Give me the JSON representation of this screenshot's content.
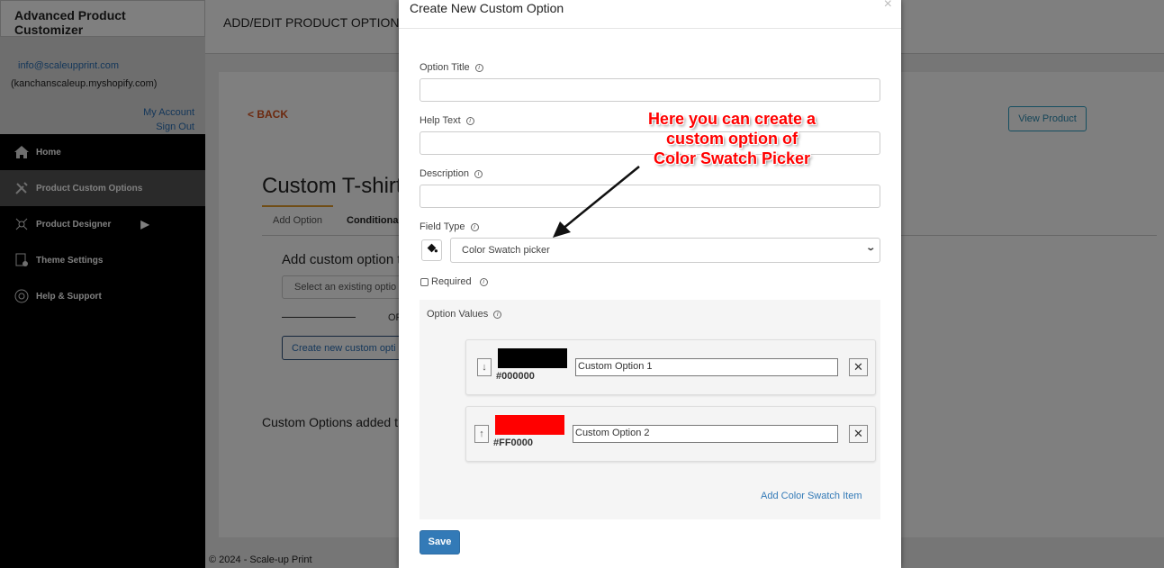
{
  "sidebar": {
    "app_title": "Advanced Product Customizer",
    "email": "info@scaleupprint.com",
    "shop": "(kanchanscaleup.myshopify.com)",
    "my_account": "My Account",
    "sign_out": "Sign Out",
    "items": [
      {
        "label": "Home",
        "icon": "home-icon"
      },
      {
        "label": "Product Custom Options",
        "icon": "tools-icon",
        "active": true
      },
      {
        "label": "Product Designer",
        "icon": "designer-icon"
      },
      {
        "label": "Theme Settings",
        "icon": "theme-settings-icon"
      },
      {
        "label": "Help & Support",
        "icon": "lifebuoy-icon"
      }
    ]
  },
  "header": {
    "title": "ADD/EDIT PRODUCT OPTIONS"
  },
  "page": {
    "back": "< BACK",
    "view_product": "View Product",
    "product_title": "Custom T-shirt",
    "tabs": [
      "Add Option",
      "Conditional"
    ],
    "add_custom_heading": "Add custom option t",
    "select_placeholder": "Select an existing optio",
    "or": "OR",
    "create_new": "Create new custom opti",
    "added_heading": "Custom Options added t"
  },
  "footer": "© 2024 - Scale-up Print",
  "modal": {
    "title": "Create New Custom Option",
    "close": "×",
    "option_title_label": "Option Title",
    "help_text_label": "Help Text",
    "description_label": "Description",
    "field_type_label": "Field Type",
    "field_type_value": "Color Swatch picker",
    "required_label": "Required",
    "option_values_label": "Option Values",
    "values": [
      {
        "hex": "#000000",
        "name": "Custom Option 1",
        "arrow": "↓"
      },
      {
        "hex": "#FF0000",
        "name": "Custom Option 2",
        "arrow": "↑"
      }
    ],
    "add_item": "Add Color Swatch Item",
    "save": "Save"
  },
  "annotation": {
    "line1": "Here you can create a",
    "line2": "custom option of",
    "line3": "Color Swatch Picker"
  },
  "colors": {
    "accent": "#337ab7",
    "back": "#d9531e",
    "annotation": "#ff0000"
  }
}
